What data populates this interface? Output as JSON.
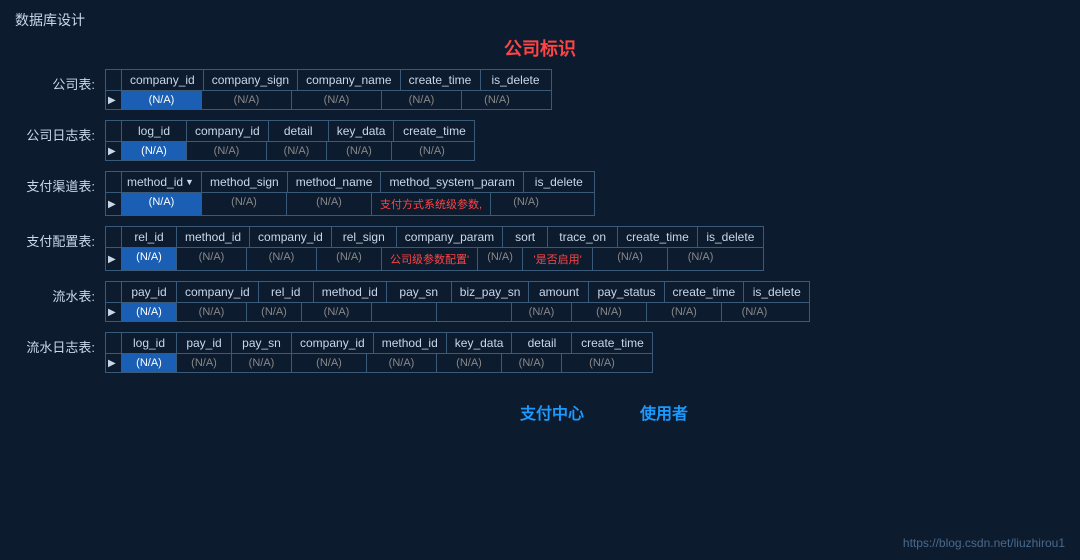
{
  "page": {
    "title": "数据库设计",
    "company_sign_label": "公司标识",
    "watermark": "https://blog.csdn.net/liuzhirou1"
  },
  "tables": [
    {
      "label": "公司表:",
      "columns": [
        "company_id",
        "company_sign",
        "company_name",
        "create_time",
        "is_delete"
      ],
      "widths": [
        80,
        90,
        90,
        80,
        70
      ],
      "row": [
        "(N/A)",
        "(N/A)",
        "(N/A)",
        "(N/A)",
        "(N/A)"
      ],
      "highlights": [
        0
      ],
      "red_cells": []
    },
    {
      "label": "公司日志表:",
      "columns": [
        "log_id",
        "company_id",
        "detail",
        "key_data",
        "create_time"
      ],
      "widths": [
        65,
        80,
        60,
        65,
        80
      ],
      "row": [
        "(N/A)",
        "(N/A)",
        "(N/A)",
        "(N/A)",
        "(N/A)"
      ],
      "highlights": [
        0
      ],
      "red_cells": []
    },
    {
      "label": "支付渠道表:",
      "columns": [
        "method_id",
        "method_sign",
        "method_name",
        "method_system_param",
        "is_delete"
      ],
      "widths": [
        80,
        85,
        85,
        115,
        70
      ],
      "row": [
        "(N/A)",
        "(N/A)",
        "(N/A)",
        "支付方式系统级参数,",
        "(N/A)"
      ],
      "highlights": [
        0
      ],
      "red_cells": [
        3
      ],
      "has_dropdown": 0
    },
    {
      "label": "支付配置表:",
      "columns": [
        "rel_id",
        "method_id",
        "company_id",
        "rel_sign",
        "company_param",
        "sort",
        "trace_on",
        "create_time",
        "is_delete"
      ],
      "widths": [
        55,
        70,
        70,
        65,
        80,
        45,
        70,
        75,
        65
      ],
      "row": [
        "(N/A)",
        "(N/A)",
        "(N/A)",
        "(N/A)",
        "公司级参数配置'",
        "(N/A)",
        "'是否启用'",
        "(N/A)",
        "(N/A)"
      ],
      "highlights": [
        0
      ],
      "red_cells": [
        4,
        6
      ]
    },
    {
      "label": "流水表:",
      "columns": [
        "pay_id",
        "company_id",
        "rel_id",
        "method_id",
        "pay_sn",
        "biz_pay_sn",
        "amount",
        "pay_status",
        "create_time",
        "is_delete"
      ],
      "widths": [
        55,
        70,
        55,
        70,
        65,
        75,
        60,
        75,
        75,
        65
      ],
      "row": [
        "(N/A)",
        "(N/A)",
        "(N/A)",
        "(N/A)",
        "",
        "",
        "(N/A)",
        "(N/A)",
        "(N/A)",
        "(N/A)"
      ],
      "highlights": [
        0
      ],
      "red_cells": [],
      "has_center_labels": true
    },
    {
      "label": "流水日志表:",
      "columns": [
        "log_id",
        "pay_id",
        "pay_sn",
        "company_id",
        "method_id",
        "key_data",
        "detail",
        "create_time"
      ],
      "widths": [
        55,
        55,
        60,
        75,
        70,
        65,
        60,
        80
      ],
      "row": [
        "(N/A)",
        "(N/A)",
        "(N/A)",
        "(N/A)",
        "(N/A)",
        "(N/A)",
        "(N/A)",
        "(N/A)"
      ],
      "highlights": [
        0
      ],
      "red_cells": []
    }
  ]
}
